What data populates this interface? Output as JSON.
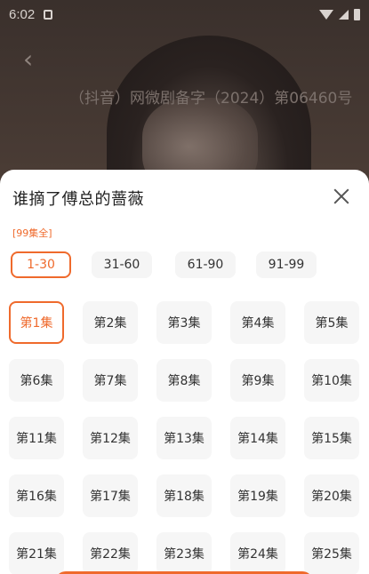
{
  "status": {
    "time": "6:02"
  },
  "video": {
    "license_text": "（抖音）网微剧备字（2024）第06460号"
  },
  "sheet": {
    "title": "谁摘了傅总的蔷薇",
    "total_badge": "[99集全]",
    "ranges": [
      "1-30",
      "31-60",
      "61-90",
      "91-99"
    ],
    "active_range": "1-30",
    "episodes": [
      "第1集",
      "第2集",
      "第3集",
      "第4集",
      "第5集",
      "第6集",
      "第7集",
      "第8集",
      "第9集",
      "第10集",
      "第11集",
      "第12集",
      "第13集",
      "第14集",
      "第15集",
      "第16集",
      "第17集",
      "第18集",
      "第19集",
      "第20集",
      "第21集",
      "第22集",
      "第23集",
      "第24集",
      "第25集"
    ],
    "active_episode": "第1集"
  },
  "colors": {
    "accent": "#ef6a2c"
  }
}
